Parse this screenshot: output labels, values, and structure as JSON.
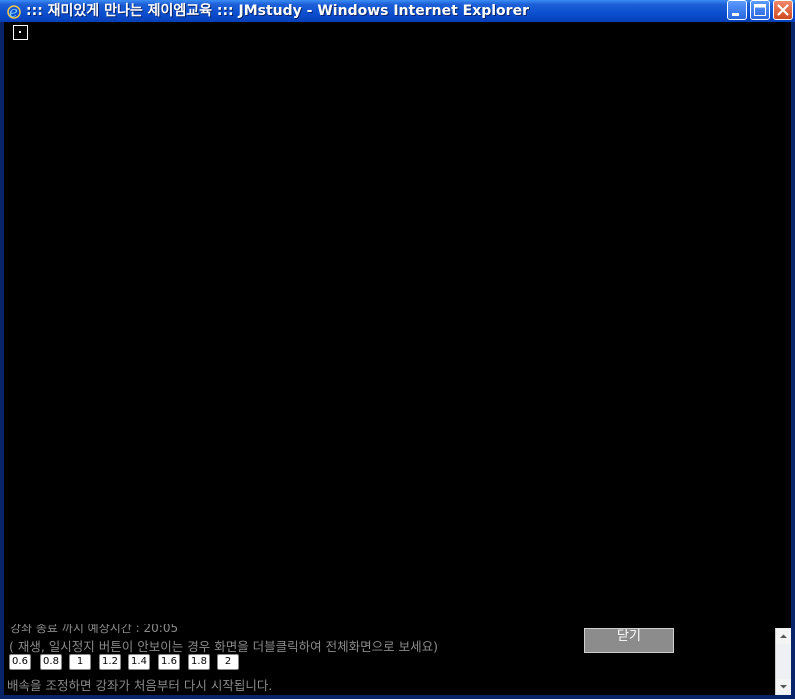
{
  "window": {
    "title": "::: 재미있게 만나는 제이엠교육 ::: JMstudy - Windows Internet Explorer",
    "app_icon": "internet-explorer-icon",
    "controls": {
      "minimize_icon": "minimize-icon",
      "maximize_icon": "maximize-icon",
      "close_icon": "close-icon"
    },
    "colors": {
      "titlebar": "#0a4fd0",
      "content_background": "#000000",
      "close_button": "#d04a22"
    }
  },
  "player": {
    "fullscreen_toggle_icon": "dot-square-icon"
  },
  "footer": {
    "course_end_info": "강좌 종료 까지 예상시간 : 20:05",
    "hint": "( 재생, 일시정지 버튼이 안보이는 경우 화면을 더블클릭하여 전체화면으로 보세요)",
    "close_label": "닫기",
    "speed_options": [
      "0.6",
      "0.8",
      "1",
      "1.2",
      "1.4",
      "1.6",
      "1.8",
      "2"
    ],
    "speed_note": "배속을 조정하면 강좌가 처음부터 다시 시작됩니다."
  }
}
